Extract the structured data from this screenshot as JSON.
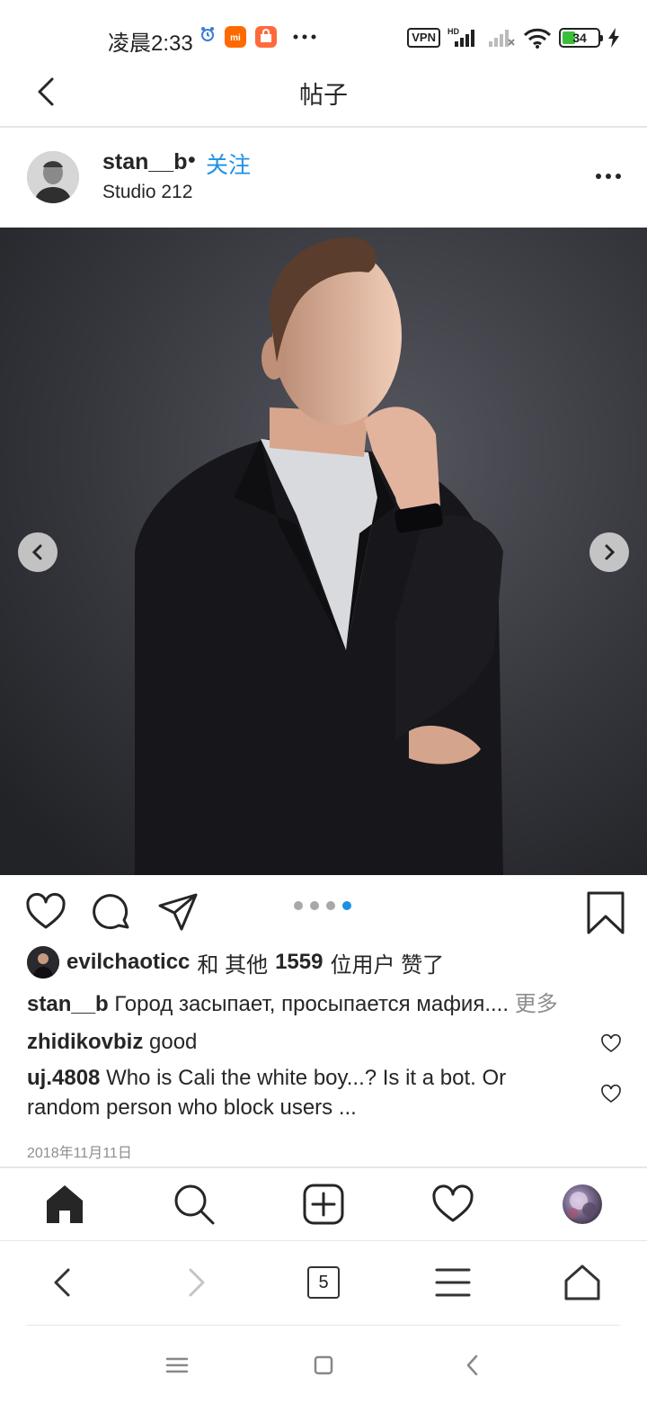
{
  "status_bar": {
    "time": "凌晨2:33",
    "vpn_label": "VPN",
    "network_label": "HD",
    "battery": "34",
    "battery_level": 0.34
  },
  "header": {
    "title": "帖子",
    "back_icon": "chevron-left-icon"
  },
  "post": {
    "username": "stan__b",
    "follow_separator": "•",
    "follow_label": "关注",
    "location": "Studio 212",
    "more_icon": "more-horizontal-icon",
    "carousel": {
      "total": 4,
      "active_index": 3
    },
    "likes": {
      "liker": "evilchaoticc",
      "connector": "和 其他",
      "count": "1559",
      "suffix": "位用户 赞了"
    },
    "caption": {
      "author": "stan__b",
      "text": "Город засыпает, просыпается мафия....",
      "more": "更多"
    },
    "comments": [
      {
        "author": "zhidikovbiz",
        "text": "good"
      },
      {
        "author": "uj.4808",
        "text": "Who is Cali the white boy...? Is it a bot. Or random person who block users ..."
      }
    ],
    "date": "2018年11月11日"
  },
  "tab_bar": {
    "items": [
      "home-icon",
      "search-icon",
      "new-post-icon",
      "activity-heart-icon",
      "profile-avatar"
    ]
  },
  "browser_bar": {
    "tab_count": "5"
  },
  "colors": {
    "accent": "#1e90e6",
    "text": "#262626",
    "muted": "#8e8e8e"
  }
}
